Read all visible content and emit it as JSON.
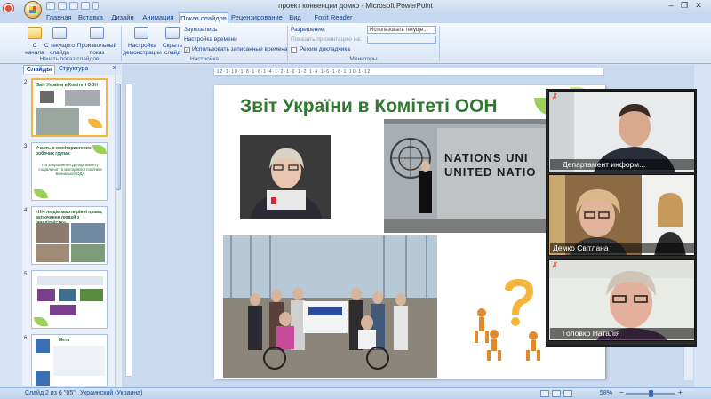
{
  "window": {
    "title": "проект конвенции домко - Microsoft PowerPoint",
    "minimize": "‒",
    "maximize": "❐",
    "close": "✕"
  },
  "tabs": [
    "Главная",
    "Вставка",
    "Дизайн",
    "Анимация",
    "Показ слайдов",
    "Рецензирование",
    "Вид",
    "Foxit Reader PDF"
  ],
  "active_tab": "Показ слайдов",
  "ribbon": {
    "from_start": "С\nначала",
    "from_current": "С текущего\nслайда",
    "custom_show": "Произвольный\nпоказ",
    "setup_show": "Настройка\nдемонстрации",
    "hide_slide": "Скрыть\nслайд",
    "record_narration": "Звукозапись",
    "rehearse_timings": "Настройка времени",
    "use_timings": "Использовать записанные времена",
    "resolution_label": "Разрешение:",
    "resolution_value": "Использовать текуще...",
    "show_on_label": "Показать презентацию на:",
    "presenter_view": "Режим докладчика",
    "group_start": "Начать показ слайдов",
    "group_setup": "Настройка",
    "group_monitors": "Мониторы"
  },
  "pane": {
    "tab_slides": "Слайды",
    "tab_outline": "Структура",
    "close": "x",
    "thumbs": [
      {
        "num": "2",
        "title": "Звіт України в Комітеті ООН"
      },
      {
        "num": "3",
        "title": "Участь в моніторингових робочих групах",
        "body": "На запрошення Департаменту соціальної та молодіжної політики Вінницької ОДА"
      },
      {
        "num": "4",
        "title": "«Ніч людів мають рівні права, включення людей з інвалідністю»"
      },
      {
        "num": "5",
        "title": ""
      },
      {
        "num": "6",
        "title": "Мета"
      }
    ]
  },
  "slide": {
    "title": "Звіт України в Комітеті ООН",
    "un_line1": "NATIONS UNI",
    "un_line2": "UNITED NATIO"
  },
  "status": {
    "slide_pos": "Слайд 2 из 6",
    "theme": "\"05\"",
    "language": "Украинский (Украина)",
    "zoom": "58%"
  },
  "video": {
    "participants": [
      {
        "name": "Департамент информ..."
      },
      {
        "name": "Демко Світлана"
      },
      {
        "name": "Головко Наталія"
      }
    ]
  },
  "colors": {
    "title_green": "#2f7a2f",
    "accent_orange": "#f4b53a",
    "ribbon_blue": "#15428b"
  }
}
